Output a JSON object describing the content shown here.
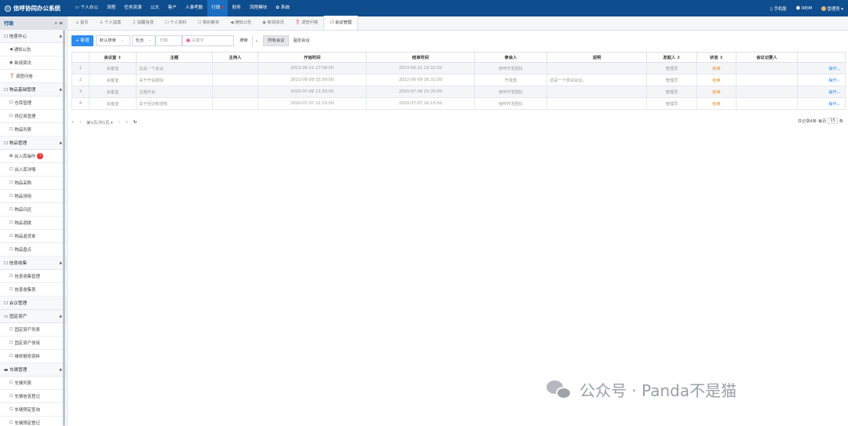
{
  "app": {
    "title": "信呼协同办公系统"
  },
  "nav": [
    "个人办公",
    "流程",
    "任务资源",
    "公文",
    "客户",
    "人事考勤",
    "行政",
    "财务",
    "流程模块",
    "系统"
  ],
  "nav_active": "行政",
  "topright": {
    "mobile": "手机版",
    "reim": "REIM",
    "user": "管理员"
  },
  "sidebar": {
    "head": "行政",
    "groups": [
      {
        "label": "信息中心",
        "items": [
          "通知公告",
          "新闻资讯",
          "调查问卷"
        ]
      },
      {
        "label": "物品基础管理",
        "items": [
          "仓库管理",
          "供应商管理",
          "物品列表"
        ]
      },
      {
        "label": "物品管理",
        "items": [
          "出入库操作",
          "出入库详情",
          "物品采购",
          "物品领用",
          "物品归还",
          "物品调拨",
          "物品退货单",
          "物品盘点"
        ]
      },
      {
        "label": "信息收集",
        "items": [
          "信息收集管理",
          "信息收集表"
        ]
      },
      {
        "label": "会议管理",
        "items": []
      },
      {
        "label": "固定资产",
        "items": [
          "固定资产列表",
          "固定资产领用",
          "维修报修资料"
        ]
      },
      {
        "label": "车辆管理",
        "items": [
          "车辆列表",
          "车辆信息登记",
          "车辆预定查询",
          "车辆预定登记"
        ]
      }
    ],
    "badge": "1"
  },
  "tabs": [
    "首页",
    "个人提案",
    "提醒信息",
    "个人资料",
    "我的薪资",
    "通知公告",
    "新闻资讯",
    "调查问卷",
    "会议管理"
  ],
  "toolbar": {
    "add": "新增",
    "search_type": "默认搜索",
    "op": "包含",
    "date_placeholder": "日期",
    "keyword_placeholder": "关键字",
    "search": "搜索",
    "all_meetings": "所有会议",
    "fixed_meetings": "固定会议"
  },
  "table": {
    "headers": [
      "",
      "会议室 ⇕",
      "主题",
      "主持人",
      "开始时间",
      "结束时间",
      "参会人",
      "说明",
      "发起人 ⇕",
      "状态 ⇕",
      "会议记要人",
      ""
    ],
    "rows": [
      [
        "1",
        "会客室",
        "这是一个会议",
        "",
        "2023-09-21 17:58:00",
        "2023-09-21 23:32:00",
        "信呼开发团队",
        "",
        "管理员",
        "结束",
        "",
        "操作⌄"
      ],
      [
        "2",
        "会客室",
        "关于开会模拟",
        "",
        "2022-09-09 15:59:00",
        "2022-09-09 16:31:00",
        "开发部",
        "这是一个测试会议。",
        "管理员",
        "结束",
        "",
        "操作⌄"
      ],
      [
        "3",
        "会客室",
        "主题开会",
        "",
        "2020-07-08 13:30:00",
        "2020-07-08 15:20:00",
        "信呼开发团队",
        "",
        "管理员",
        "结束",
        "",
        "操作⌄"
      ],
      [
        "4",
        "会客室",
        "关于回访新增规",
        "",
        "2020-07-07 11:15:00",
        "2020-07-07 16:15:00",
        "信呼开发团队",
        "",
        "管理员",
        "结束",
        "",
        "操作⌄"
      ]
    ]
  },
  "pager": {
    "page": "第1页/共1页",
    "total": "共记录4条",
    "per_label": "每页",
    "per": "15",
    "unit": "条"
  },
  "watermark": "公众号 · Panda不是猫"
}
